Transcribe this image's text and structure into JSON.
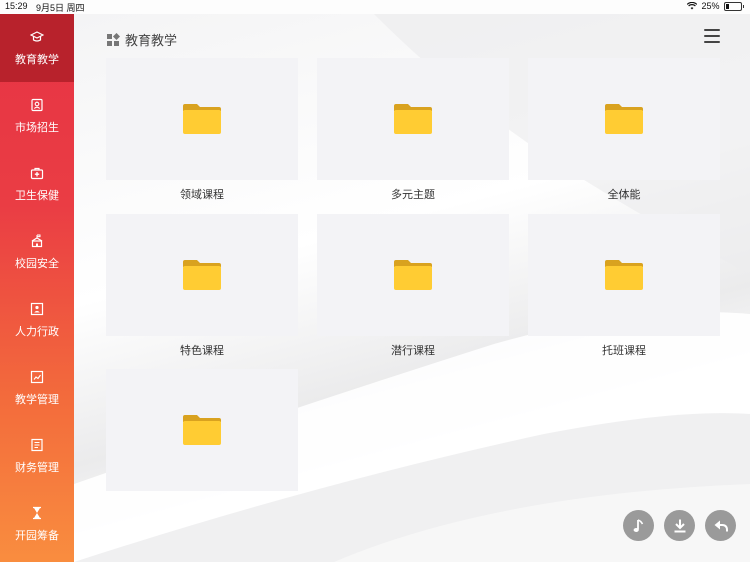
{
  "status_bar": {
    "time": "15:29",
    "date": "9月5日 周四",
    "battery": "25%"
  },
  "header": {
    "title": "教育教学"
  },
  "sidebar": {
    "items": [
      {
        "label": "教育教学",
        "icon": "graduation-cap-icon"
      },
      {
        "label": "市场招生",
        "icon": "contact-card-icon"
      },
      {
        "label": "卫生保健",
        "icon": "medical-kit-icon"
      },
      {
        "label": "校园安全",
        "icon": "school-building-icon"
      },
      {
        "label": "人力行政",
        "icon": "staff-board-icon"
      },
      {
        "label": "教学管理",
        "icon": "teaching-panel-icon"
      },
      {
        "label": "财务管理",
        "icon": "ledger-icon"
      },
      {
        "label": "开园筹备",
        "icon": "hourglass-icon"
      }
    ]
  },
  "folders": [
    {
      "label": "领域课程",
      "icon": "folder-icon"
    },
    {
      "label": "多元主题",
      "icon": "folder-icon"
    },
    {
      "label": "全体能",
      "icon": "folder-icon"
    },
    {
      "label": "特色课程",
      "icon": "folder-icon"
    },
    {
      "label": "潜行课程",
      "icon": "folder-icon"
    },
    {
      "label": "托班课程",
      "icon": "folder-icon"
    },
    {
      "label": "",
      "icon": "folder-icon"
    }
  ],
  "bottom_actions": [
    {
      "icon": "music-note-icon"
    },
    {
      "icon": "download-icon"
    },
    {
      "icon": "back-arrow-icon"
    }
  ],
  "colors": {
    "sidebar_top": "#e63345",
    "sidebar_bottom": "#f98d3f",
    "active_item": "#b8222c",
    "folder_yellow": "#ffcc33",
    "folder_tab": "#d9a21f",
    "tile_bg": "#f3f3f6"
  }
}
